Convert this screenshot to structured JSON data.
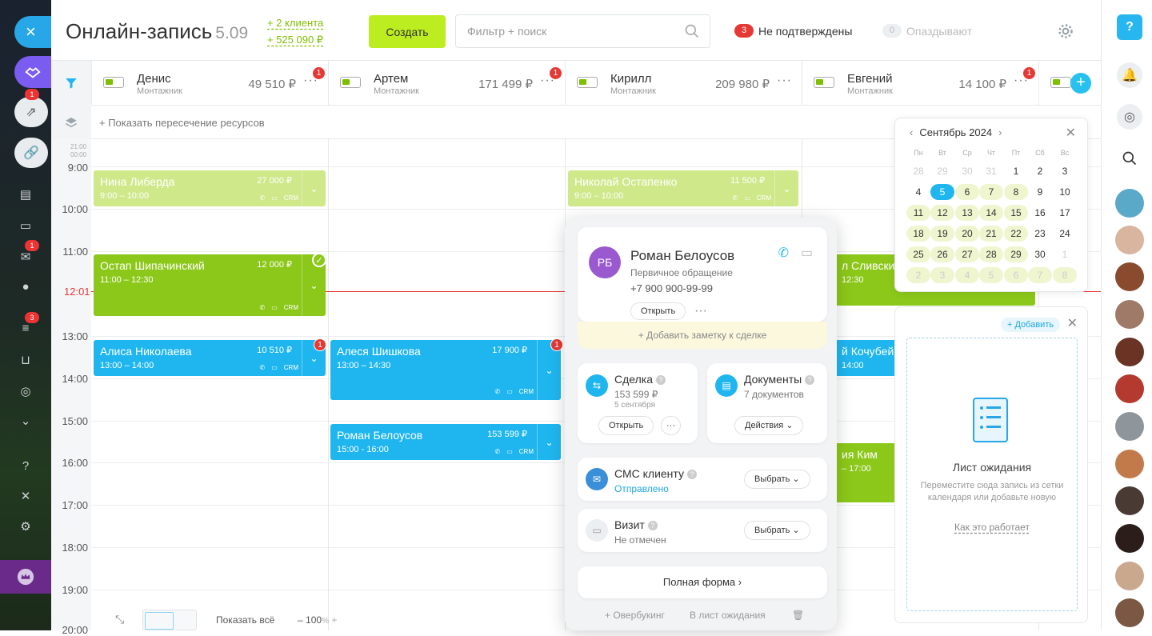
{
  "sidebar": {
    "close_icon": "×",
    "badges": {
      "b1": "1",
      "b2": "1",
      "b3": "3"
    }
  },
  "header": {
    "title": "Онлайн-запись",
    "date": "5.09",
    "stat_clients": "+ 2 клиента",
    "stat_amount": "+ 525 090 ₽",
    "create_label": "Создать",
    "search_placeholder": "Фильтр + поиск",
    "unconfirmed_count": "3",
    "unconfirmed_label": "Не подтверждены",
    "late_count": "0",
    "late_label": "Опаздывают"
  },
  "resources": [
    {
      "name": "Денис",
      "role": "Монтажник",
      "amount": "49 510 ₽",
      "badge": "1"
    },
    {
      "name": "Артем",
      "role": "Монтажник",
      "amount": "171 499 ₽",
      "badge": "1"
    },
    {
      "name": "Кирилл",
      "role": "Монтажник",
      "amount": "209 980 ₽",
      "badge": ""
    },
    {
      "name": "Евгений",
      "role": "Монтажник",
      "amount": "14 100 ₽",
      "badge": "1"
    }
  ],
  "overlap_link": "+ Показать пересечение ресурсов",
  "times": {
    "pre": "21:00",
    "pre2": "00:00",
    "t9": "9:00",
    "t10": "10:00",
    "t11": "11:00",
    "now": "12:01",
    "t13": "13:00",
    "t14": "14:00",
    "t15": "15:00",
    "t16": "16:00",
    "t17": "17:00",
    "t18": "18:00",
    "t19": "19:00",
    "t20": "20:00"
  },
  "appointments": {
    "a1": {
      "name": "Нина Либерда",
      "price": "27 000 ₽",
      "time": "9:00 – 10:00",
      "crm": "CRM"
    },
    "a2": {
      "name": "Николай Остапенко",
      "price": "11 500 ₽",
      "time": "9:00 – 10:00",
      "crm": "CRM"
    },
    "a3": {
      "name": "Остап Шипачинский",
      "price": "12 000 ₽",
      "time": "11:00 – 12:30",
      "crm": "CRM"
    },
    "a4": {
      "name": "Алиса Николаева",
      "price": "10 510 ₽",
      "time": "13:00 – 14:00",
      "crm": "CRM",
      "badge": "1"
    },
    "a5": {
      "name": "Алеся Шишкова",
      "price": "17 900 ₽",
      "time": "13:00 – 14:30",
      "crm": "CRM",
      "badge": "1"
    },
    "a6": {
      "name": "Роман Белоусов",
      "price": "153 599 ₽",
      "time": "15:00 - 16:00",
      "crm": "CRM"
    },
    "a7": {
      "name": "л Сливски",
      "time": "12:30"
    },
    "a8": {
      "name": "й Кочубей",
      "time": "14:00"
    },
    "a9": {
      "name": "ия Ким",
      "time": "– 17:00"
    }
  },
  "popup": {
    "initials": "РБ",
    "name": "Роман Белоусов",
    "status": "Первичное обращение",
    "phone": "+7 900 900-99-99",
    "open_label": "Открыть",
    "add_note": "+ Добавить заметку к сделке",
    "deal": {
      "title": "Сделка",
      "amount": "153 599 ₽",
      "date": "5 сентября",
      "open_label": "Открыть"
    },
    "docs": {
      "title": "Документы",
      "count": "7 документов",
      "actions_label": "Действия"
    },
    "sms": {
      "title": "СМС клиенту",
      "status": "Отправлено",
      "select_label": "Выбрать"
    },
    "visit": {
      "title": "Визит",
      "status": "Не отмечен",
      "select_label": "Выбрать"
    },
    "full_form": "Полная форма",
    "overbooking": "+ Овербукинг",
    "to_waitlist": "В лист ожидания"
  },
  "calendar": {
    "month": "Сентябрь 2024",
    "weekdays": [
      "Пн",
      "Вт",
      "Ср",
      "Чт",
      "Пт",
      "Сб",
      "Вс"
    ],
    "weeks": [
      [
        "28",
        "29",
        "30",
        "31",
        "1",
        "2",
        "3"
      ],
      [
        "4",
        "5",
        "6",
        "7",
        "8",
        "9",
        "10"
      ],
      [
        "11",
        "12",
        "13",
        "14",
        "15",
        "16",
        "17"
      ],
      [
        "18",
        "19",
        "20",
        "21",
        "22",
        "23",
        "24"
      ],
      [
        "25",
        "26",
        "27",
        "28",
        "29",
        "30",
        "1"
      ],
      [
        "2",
        "3",
        "4",
        "5",
        "6",
        "7",
        "8"
      ]
    ]
  },
  "waitlist": {
    "add_label": "+ Добавить",
    "title": "Лист ожидания",
    "text": "Переместите сюда запись из сетки календаря или добавьте новую",
    "how_link": "Как это работает"
  },
  "bottombar": {
    "show_all": "Показать всё",
    "zoom": "100",
    "zoom_unit": "%"
  },
  "colors": {
    "accent": "#1fb6f0",
    "green": "#8cc81a",
    "create": "#bbed21",
    "red": "#e53935",
    "purple": "#7b5cf0"
  }
}
